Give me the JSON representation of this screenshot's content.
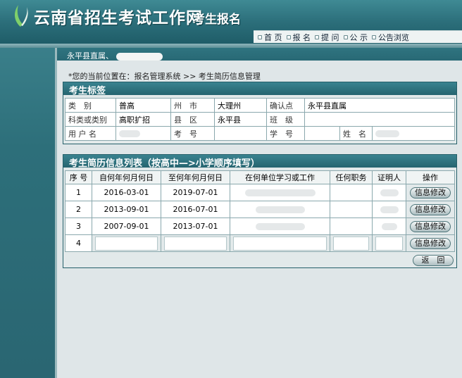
{
  "header": {
    "site_title": "云南省招生考试工作网",
    "sub_title": "考生报名",
    "nav": [
      "首 页",
      "报 名",
      "提 问",
      "公 示",
      "公告浏览"
    ]
  },
  "user_bar": {
    "text": "永平县直属、"
  },
  "breadcrumb": "*您的当前位置在：报名管理系统 >> 考生简历信息管理",
  "candidate": {
    "title": "考生标签",
    "row1": {
      "l1": "类　别",
      "v1": "普高",
      "l2": "州　市",
      "v2": "大理州",
      "l3": "确认点",
      "v3": "永平县直属"
    },
    "row2": {
      "l1": "科类或类别",
      "v1": "高职扩招",
      "l2": "县　区",
      "v2": "永平县",
      "l3": "班　级",
      "v3": ""
    },
    "row3": {
      "l1": "用 户 名",
      "l2": "考　号",
      "l3": "学　号",
      "l4": "姓　名"
    }
  },
  "history": {
    "title": "考生简历信息列表（按高中—>小学顺序填写）",
    "columns": [
      "序 号",
      "自何年何月何日",
      "至何年何月何日",
      "在何单位学习或工作",
      "任何职务",
      "证明人",
      "操作"
    ],
    "rows": [
      {
        "no": "1",
        "from": "2016-03-01",
        "to": "2019-07-01",
        "action": "信息修改"
      },
      {
        "no": "2",
        "from": "2013-09-01",
        "to": "2016-07-01",
        "action": "信息修改"
      },
      {
        "no": "3",
        "from": "2007-09-01",
        "to": "2013-07-01",
        "action": "信息修改"
      },
      {
        "no": "4",
        "from": "",
        "to": "",
        "action": "信息修改"
      }
    ],
    "back_label": "返　回"
  },
  "colors": {
    "header": "#2c6f7b",
    "panel_head": "#25646f",
    "background": "#dfe6e8"
  }
}
